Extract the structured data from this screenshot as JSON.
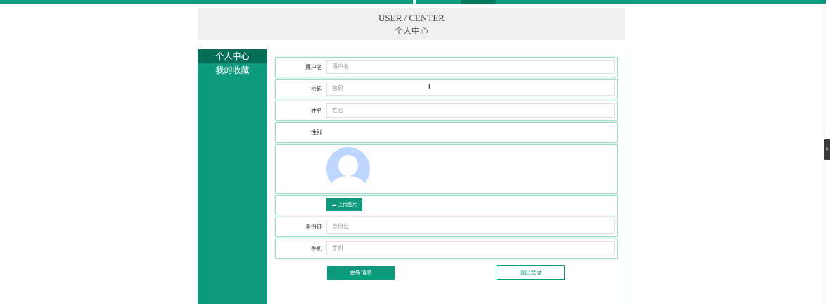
{
  "header": {
    "title_en": "USER / CENTER",
    "title_zh": "个人中心"
  },
  "sidebar": {
    "items": [
      {
        "label": "个人中心",
        "active": true
      },
      {
        "label": "我的收藏",
        "active": false
      }
    ]
  },
  "form": {
    "username": {
      "label": "用户名",
      "placeholder": "用户名"
    },
    "password": {
      "label": "密码",
      "placeholder": "密码"
    },
    "name": {
      "label": "姓名",
      "placeholder": "姓名"
    },
    "gender": {
      "label": "性别"
    },
    "photo": {
      "upload_label": "上传图片"
    },
    "idcard": {
      "label": "身份证",
      "placeholder": "身份证"
    },
    "phone": {
      "label": "手机",
      "placeholder": "手机"
    }
  },
  "actions": {
    "update_label": "更新信息",
    "logout_label": "退出登录"
  },
  "colors": {
    "accent": "#0d9a7c",
    "accent_dark": "#076f59",
    "avatar_bg": "#bcd6ff"
  },
  "icons": {
    "upload": "cloud-upload-icon",
    "avatar": "user-avatar-icon",
    "edge": "chevron-left-icon"
  }
}
